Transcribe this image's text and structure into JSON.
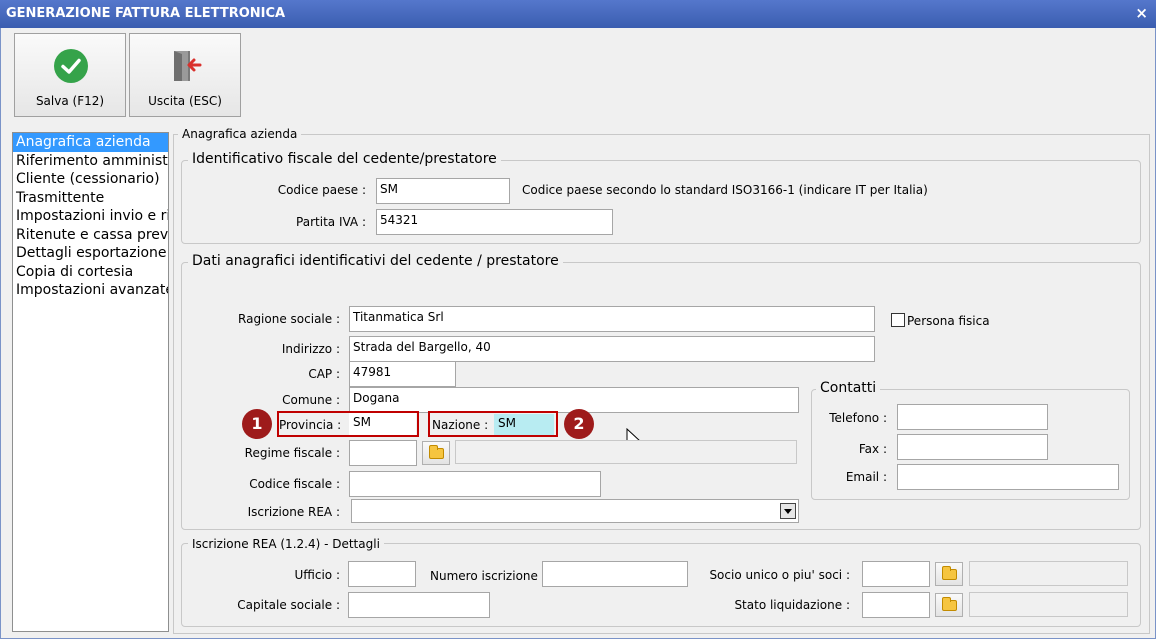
{
  "window": {
    "title": "GENERAZIONE FATTURA ELETTRONICA",
    "close_glyph": "×"
  },
  "toolbar": {
    "save_label": "Salva (F12)",
    "exit_label": "Uscita (ESC)",
    "save_icon": "check-circle-icon",
    "exit_icon": "exit-door-icon",
    "save_color": "#35a34a",
    "exit_color": "#d9302c"
  },
  "nav": {
    "items": [
      "Anagrafica azienda",
      "Riferimento amministrativo",
      "Cliente (cessionario)",
      "Trasmittente",
      "Impostazioni invio e ricezione",
      "Ritenute e cassa previdenza",
      "Dettagli esportazione",
      "Copia di cortesia",
      "Impostazioni avanzate"
    ]
  },
  "section": {
    "title": "Anagrafica azienda",
    "fiscal": {
      "title": "Identificativo fiscale del cedente/prestatore",
      "codice_paese_label": "Codice paese :",
      "codice_paese": "SM",
      "codice_paese_hint": "Codice paese secondo lo standard ISO3166-1 (indicare IT per Italia)",
      "partita_iva_label": "Partita IVA :",
      "partita_iva": "54321"
    },
    "anagrafici": {
      "title": "Dati anagrafici identificativi del cedente / prestatore",
      "ragione_sociale_label": "Ragione sociale :",
      "ragione_sociale": "Titanmatica Srl",
      "persona_fisica_label": "Persona fisica",
      "indirizzo_label": "Indirizzo :",
      "indirizzo": "Strada del Bargello, 40",
      "cap_label": "CAP :",
      "cap": "47981",
      "comune_label": "Comune :",
      "comune": "Dogana",
      "provincia_label": "Provincia :",
      "provincia": "SM",
      "nazione_label": "Nazione :",
      "nazione": "SM",
      "regime_label": "Regime fiscale :",
      "regime": "",
      "codice_fiscale_label": "Codice fiscale :",
      "codice_fiscale": "",
      "iscrizione_rea_label": "Iscrizione REA :",
      "iscrizione_rea": "",
      "badge1": "1",
      "badge2": "2"
    },
    "contatti": {
      "title": "Contatti",
      "telefono_label": "Telefono :",
      "fax_label": "Fax :",
      "email_label": "Email :"
    },
    "rea": {
      "title": "Iscrizione REA (1.2.4) - Dettagli",
      "ufficio_label": "Ufficio :",
      "numero_label": "Numero iscrizione :",
      "socio_label": "Socio unico o piu' soci :",
      "capitale_label": "Capitale sociale :",
      "stato_label": "Stato liquidazione :"
    }
  }
}
